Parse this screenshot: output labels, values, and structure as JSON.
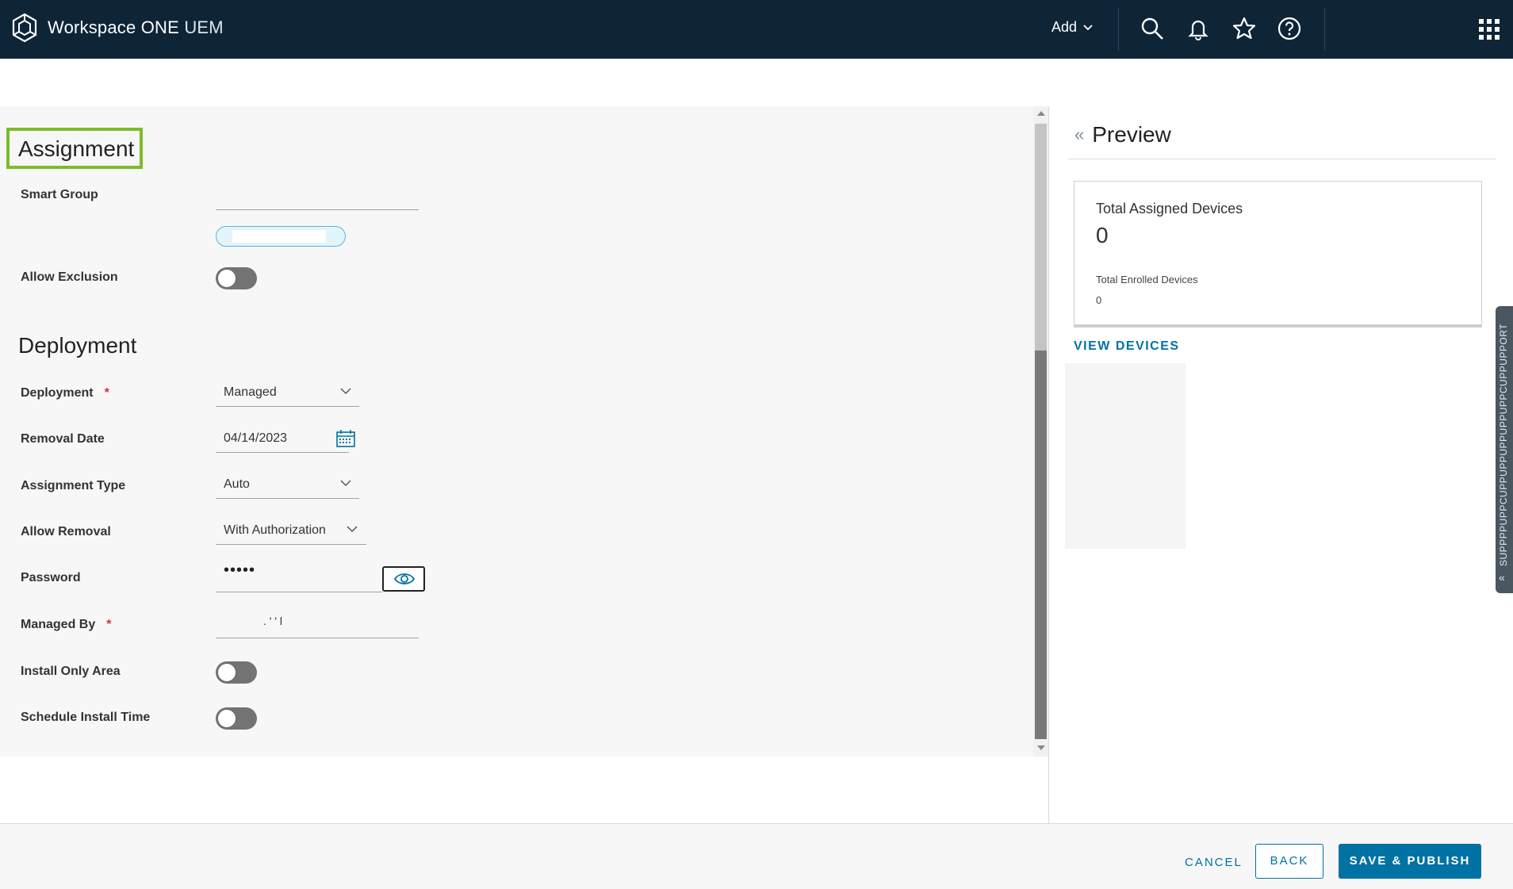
{
  "app": {
    "title_main": "Workspace ONE",
    "title_product": "UEM"
  },
  "topbar": {
    "add_label": "Add"
  },
  "assignment": {
    "title": "Assignment",
    "smart_group_label": "Smart Group",
    "allow_exclusion_label": "Allow Exclusion",
    "allow_exclusion_on": false
  },
  "deployment": {
    "title": "Deployment",
    "deployment_label": "Deployment",
    "deployment_value": "Managed",
    "removal_date_label": "Removal Date",
    "removal_date_value": "04/14/2023",
    "assignment_type_label": "Assignment Type",
    "assignment_type_value": "Auto",
    "allow_removal_label": "Allow Removal",
    "allow_removal_value": "With Authorization",
    "password_label": "Password",
    "password_value": "•••••",
    "managed_by_label": "Managed By",
    "managed_by_value": ". ' ' l",
    "install_only_area_label": "Install Only Area",
    "install_only_area_on": false,
    "schedule_install_time_label": "Schedule Install Time",
    "schedule_install_time_on": false,
    "required_marker": "*"
  },
  "preview": {
    "title": "Preview",
    "total_assigned_label": "Total Assigned Devices",
    "total_assigned_value": "0",
    "total_enrolled_label": "Total Enrolled Devices",
    "total_enrolled_value": "0",
    "view_devices_label": "VIEW DEVICES"
  },
  "support_tab": {
    "label": "SUPPPPUPPCUPPUPPUPPUPPUPPCUPPUPPORT"
  },
  "footer": {
    "cancel_label": "CANCEL",
    "back_label": "BACK",
    "save_label": "SAVE & PUBLISH"
  },
  "colors": {
    "topbar": "#0e2537",
    "accent": "#0072a3",
    "highlight": "#7bbd2a",
    "required": "#d2333e"
  }
}
